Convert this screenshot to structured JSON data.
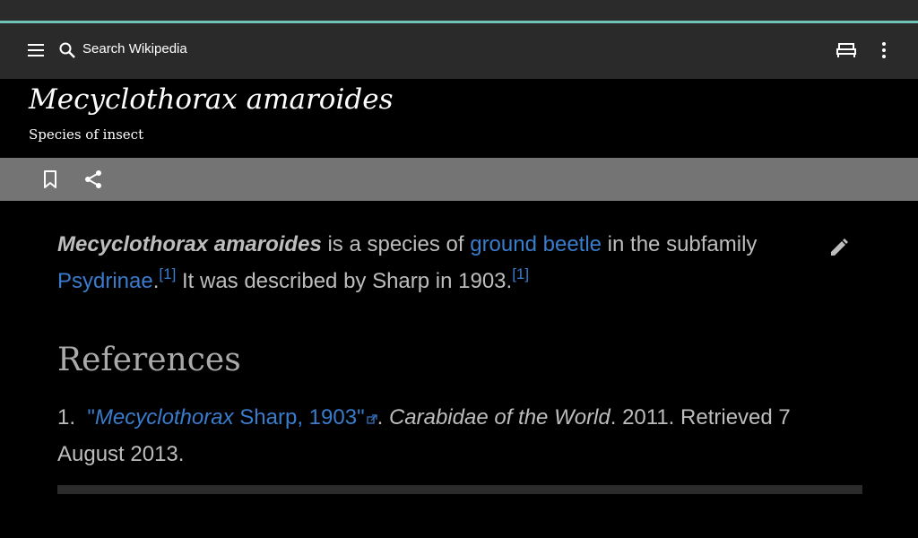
{
  "toolbar": {
    "search_placeholder": "Search Wikipedia"
  },
  "header": {
    "title": "Mecyclothorax amaroides",
    "subtitle": "Species of insect"
  },
  "article": {
    "bold_name": "Mecyclothorax amaroides",
    "text_1": " is a species of ",
    "link_ground_beetle": "ground beetle",
    "text_2": " in the subfamily ",
    "link_psydrinae": "Psydrinae",
    "text_3": ".",
    "cite_1": "[1]",
    "text_4": " It was described by Sharp in 1903.",
    "cite_2": "[1]"
  },
  "references": {
    "heading": "References",
    "items": [
      {
        "number": "1.",
        "link_italic": "Mecyclothorax",
        "link_rest": " Sharp, 1903",
        "quote_open": "\"",
        "quote_close": "\"",
        "after_link": ". ",
        "source": "Carabidae of the World",
        "rest": ". 2011. Retrieved 7 August 2013."
      }
    ]
  },
  "colors": {
    "accent_line": "#6fc4b8",
    "link": "#3a7ccc"
  },
  "icons": [
    "menu-icon",
    "search-icon",
    "reading-list-icon",
    "overflow-menu-icon",
    "bookmark-icon",
    "share-icon",
    "edit-icon",
    "external-link-icon"
  ]
}
